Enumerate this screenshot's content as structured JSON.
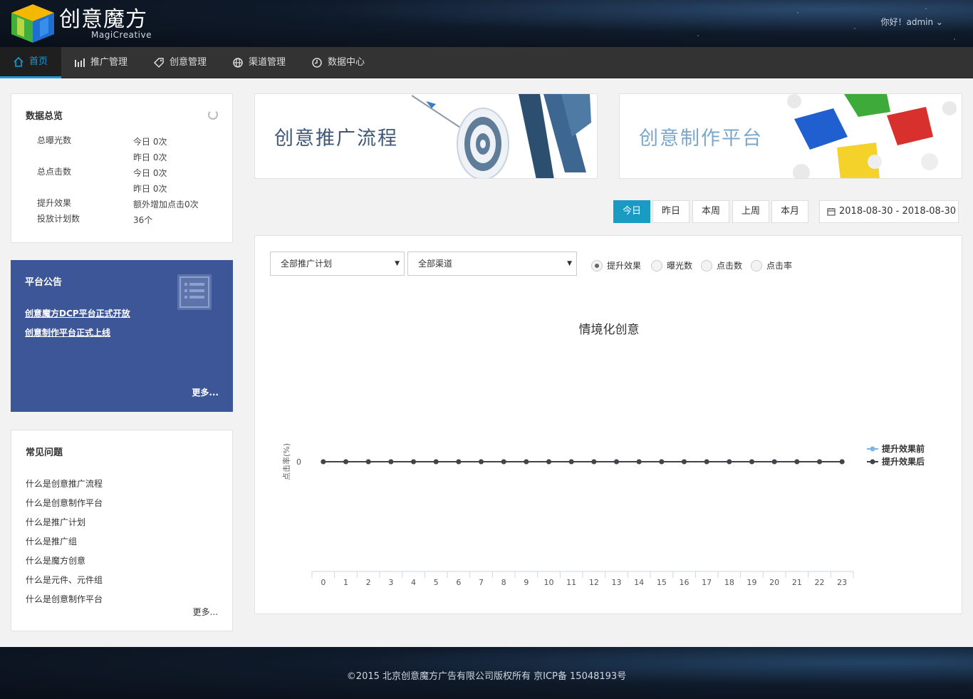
{
  "header": {
    "logo_text": "创意魔方",
    "logo_sub": "MagiCreative",
    "user_greeting": "你好！admin ⌄"
  },
  "nav": {
    "items": [
      {
        "label": "首页",
        "icon": "home-icon"
      },
      {
        "label": "推广管理",
        "icon": "bar-chart-icon"
      },
      {
        "label": "创意管理",
        "icon": "tag-icon"
      },
      {
        "label": "渠道管理",
        "icon": "globe-icon"
      },
      {
        "label": "数据中心",
        "icon": "clock-icon"
      }
    ]
  },
  "overview": {
    "title": "数据总览",
    "rows": [
      {
        "label": "总曝光数",
        "value": "今日 0次"
      },
      {
        "label": "",
        "value": "昨日 0次"
      },
      {
        "label": "总点击数",
        "value": "今日 0次"
      },
      {
        "label": "",
        "value": "昨日 0次"
      },
      {
        "label": "提升效果",
        "value": "额外增加点击0次"
      },
      {
        "label": "投放计划数",
        "value": "36个"
      }
    ]
  },
  "notice": {
    "title": "平台公告",
    "links": [
      "创意魔方DCP平台正式开放",
      "创意制作平台正式上线"
    ],
    "more": "更多..."
  },
  "faq": {
    "title": "常见问题",
    "items": [
      "什么是创意推广流程",
      "什么是创意制作平台",
      "什么是推广计划",
      "什么是推广组",
      "什么是魔方创意",
      "什么是元件、元件组",
      "什么是创意制作平台"
    ],
    "more": "更多..."
  },
  "banners": {
    "left": "创意推广流程",
    "right": "创意制作平台"
  },
  "date_filter": {
    "buttons": [
      "今日",
      "昨日",
      "本周",
      "上周",
      "本月"
    ],
    "active_index": 0,
    "range": "2018-08-30 - 2018-08-30"
  },
  "filters": {
    "plan_select": "全部推广计划",
    "channel_select": "全部渠道",
    "radios": [
      "提升效果",
      "曝光数",
      "点击数",
      "点击率"
    ],
    "radio_selected": 0
  },
  "colors": {
    "accent": "#1a9bc2",
    "notice_bg": "#3c5697",
    "series_before": "#7cb5ec",
    "series_after": "#434348"
  },
  "chart_data": {
    "type": "line",
    "title": "情境化创意",
    "ylabel": "点击率(%)",
    "xlabel": "",
    "x": [
      "0",
      "1",
      "2",
      "3",
      "4",
      "5",
      "6",
      "7",
      "8",
      "9",
      "10",
      "11",
      "12",
      "13",
      "14",
      "15",
      "16",
      "17",
      "18",
      "19",
      "20",
      "21",
      "22",
      "23"
    ],
    "y_ticks": [
      "0"
    ],
    "legend_position": "right",
    "series": [
      {
        "name": "提升效果前",
        "values": [
          0,
          0,
          0,
          0,
          0,
          0,
          0,
          0,
          0,
          0,
          0,
          0,
          0,
          0,
          0,
          0,
          0,
          0,
          0,
          0,
          0,
          0,
          0,
          0
        ]
      },
      {
        "name": "提升效果后",
        "values": [
          0,
          0,
          0,
          0,
          0,
          0,
          0,
          0,
          0,
          0,
          0,
          0,
          0,
          0,
          0,
          0,
          0,
          0,
          0,
          0,
          0,
          0,
          0,
          0
        ]
      }
    ]
  },
  "footer": {
    "copyright": "©2015 北京创意魔方广告有限公司版权所有 京ICP备 15048193号"
  }
}
